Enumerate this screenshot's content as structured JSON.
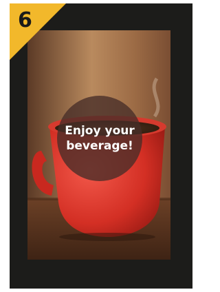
{
  "step": {
    "number": "6",
    "badge_color": "#f2b82b"
  },
  "panel": {
    "frame_color": "#1c1c1a",
    "message": "Enjoy your\nbeverage!",
    "photo_icon": "red-coffee-cup-photo"
  }
}
